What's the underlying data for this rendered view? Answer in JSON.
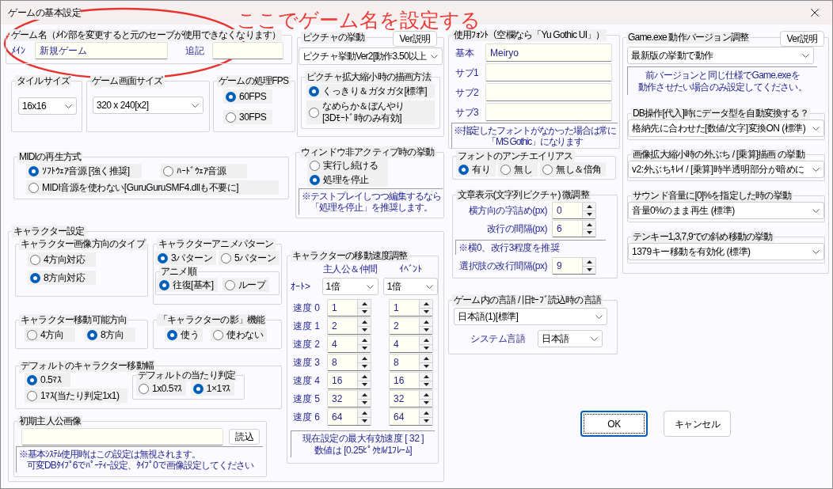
{
  "window": {
    "title": "ゲームの基本設定"
  },
  "annotation": {
    "text": "ここでゲーム名を設定する"
  },
  "game_name": {
    "legend": "ゲーム名（ﾒｲﾝ部を変更すると元のセーブが使用できなくなります）",
    "main_label": "ﾒｲﾝ",
    "main_value": "新規ゲーム",
    "extra_label": "追記"
  },
  "tile_size": {
    "legend": "タイルサイズ",
    "value": "16x16"
  },
  "screen_size": {
    "legend": "ゲーム画面サイズ",
    "value": "320 x 240[x2]"
  },
  "fps": {
    "legend": "ゲームの処理FPS",
    "options": [
      {
        "label": "60FPS",
        "selected": true
      },
      {
        "label": "30FPS",
        "selected": false
      }
    ]
  },
  "midi": {
    "legend": "MIDIの再生方式",
    "options": [
      {
        "label": "ｿﾌﾄｳｪｱ音源 [強く推奨]",
        "selected": true
      },
      {
        "label": "ﾊｰﾄﾞｳｪｱ音源",
        "selected": false
      },
      {
        "label": "MIDI音源を使わない[GuruGuruSMF4.dllも不要に]",
        "selected": false
      }
    ]
  },
  "picture": {
    "legend": "ピクチャの挙動",
    "button": "Ver説明",
    "value": "ピクチャ挙動Ver2[動作3.50以上",
    "scaling": {
      "legend": "ピクチャ拡大縮小時の描画方法",
      "options": [
        {
          "label": "くっきり＆ガタガタ[標準]",
          "selected": true
        },
        {
          "label": "なめらか＆ぼんやり[3Dﾓｰﾄﾞ時のみ有効]",
          "selected": false
        }
      ]
    }
  },
  "inactive": {
    "legend": "ウィンドウ非アクティブ時の挙動",
    "options": [
      {
        "label": "実行し続ける",
        "selected": false
      },
      {
        "label": "処理を停止",
        "selected": true
      }
    ],
    "note": [
      "※テストプレイしつつ編集するなら",
      "「処理を停止」を推奨します。"
    ]
  },
  "character": {
    "legend": "キャラクター設定",
    "direction_type": {
      "legend": "キャラクター画像方向のタイプ",
      "options": [
        {
          "label": "4方向対応",
          "selected": false
        },
        {
          "label": "8方向対応",
          "selected": true
        }
      ]
    },
    "anime_pattern": {
      "legend": "キャラクターアニメパターン",
      "options": [
        {
          "label": "3パターン",
          "selected": true
        },
        {
          "label": "5パターン",
          "selected": false
        }
      ],
      "order": {
        "legend": "アニメ順",
        "options": [
          {
            "label": "往復[基本]",
            "selected": true
          },
          {
            "label": "ループ",
            "selected": false
          }
        ]
      }
    },
    "move_direction": {
      "legend": "キャラクター移動可能方向",
      "options": [
        {
          "label": "4方向",
          "selected": false
        },
        {
          "label": "8方向",
          "selected": true
        }
      ]
    },
    "shadow": {
      "legend": "「キャラクターの影」機能",
      "options": [
        {
          "label": "使う",
          "selected": true
        },
        {
          "label": "使わない",
          "selected": false
        }
      ]
    },
    "move_width": {
      "legend": "デフォルトのキャラクター移動幅",
      "options": [
        {
          "label": "0.5ﾏｽ",
          "selected": true
        },
        {
          "label": "1ﾏｽ(当たり判定1x1)",
          "selected": false
        }
      ],
      "collision": {
        "legend": "デフォルトの当たり判定",
        "options": [
          {
            "label": "1x0.5ﾏｽ",
            "selected": false
          },
          {
            "label": "1×1ﾏｽ",
            "selected": true
          }
        ]
      }
    },
    "initial_image": {
      "legend": "初期主人公画像",
      "button": "読込",
      "note": [
        "※基本ｼｽﾃﾑ使用時はこの設定は無視されます。",
        "可変DBﾀｲﾌﾟ6でﾊﾟｰﾃｨｰ設定、ﾀｲﾌﾟ0で画像設定してください"
      ]
    },
    "speed": {
      "legend": "キャラクターの移動速度調整",
      "columns": [
        "主人公＆仲間",
        "ｲﾍﾞﾝﾄ"
      ],
      "auto_label": "ｵｰﾄ>",
      "auto_values": [
        "1倍",
        "1倍"
      ],
      "rows": [
        {
          "label": "速度 0",
          "values": [
            "1",
            "1"
          ]
        },
        {
          "label": "速度 1",
          "values": [
            "2",
            "2"
          ]
        },
        {
          "label": "速度 2",
          "values": [
            "4",
            "4"
          ]
        },
        {
          "label": "速度 3",
          "values": [
            "8",
            "8"
          ]
        },
        {
          "label": "速度 4",
          "values": [
            "16",
            "16"
          ]
        },
        {
          "label": "速度 5",
          "values": [
            "32",
            "32"
          ]
        },
        {
          "label": "速度 6",
          "values": [
            "64",
            "64"
          ]
        }
      ],
      "note": [
        "現在設定の最大有効速度 [ 32 ]",
        "数値は [0.25ﾋﾟｸｾﾙ/1ﾌﾚｰﾑ]"
      ]
    }
  },
  "fonts": {
    "legend": "使用ﾌｫﾝﾄ（空欄なら「Yu Gothic UI」）",
    "rows": [
      {
        "label": "基本",
        "value": "Meiryo"
      },
      {
        "label": "サブ1"
      },
      {
        "label": "サブ2"
      },
      {
        "label": "サブ3"
      }
    ],
    "note": [
      "※指定したフォントがなかった場合は常に",
      "「MS Gothic」になります"
    ]
  },
  "antialias": {
    "legend": "フォントのアンチエイリアス",
    "options": [
      {
        "label": "有り",
        "selected": true
      },
      {
        "label": "無し",
        "selected": false
      },
      {
        "label": "無し＆倍角",
        "selected": false
      }
    ]
  },
  "text_tuning": {
    "legend": "文章表示(文字列ピクチャ) 微調整",
    "items": [
      {
        "kind": "spinner",
        "label": "横方向の字詰め(px)",
        "value": "0"
      },
      {
        "kind": "spinner",
        "label": "改行の間隔(px)",
        "value": "6"
      },
      {
        "kind": "note",
        "text": "※横0、改行3程度を推奨"
      },
      {
        "kind": "spinner",
        "label": "選択肢の改行間隔(px)",
        "value": "9"
      }
    ]
  },
  "exe_version": {
    "legend": "Game.exe 動作バージョン調整",
    "button": "Ver説明",
    "value": "最新版の挙動で動作",
    "note": [
      "前バージョンと同じ仕様でGame.exeを",
      "動作させたい場合のみ設定してください。"
    ],
    "behaviors": [
      {
        "legend": "DB操作[代入]時にデータ型を自動変換する？",
        "value": "格納先に合わせた[数値/文字]変換ON (標準)"
      },
      {
        "legend": "画像拡大縮小時の外ぶち / [乗算]描画 の挙動",
        "value": "v2:外ぶちｷﾚｲ / [乗算]時半透明部分が暗めに"
      },
      {
        "legend": "サウンド音量に[0]%を指定した時の挙動",
        "value": "音量0%のまま再生 (標準)"
      },
      {
        "legend": "テンキー1,3,7,9での斜め移動の挙動",
        "value": "1379キー移動を有効化 (標準)"
      }
    ]
  },
  "language": {
    "legend": "ゲーム内の言語 / 旧ｾｰﾌﾞ読込時の言語",
    "value": "日本語(1)[標準]",
    "system_label": "システム言語",
    "system_value": "日本語"
  },
  "buttons": [
    {
      "label": "OK",
      "default": true
    },
    {
      "label": "キャンセル",
      "default": false
    }
  ]
}
